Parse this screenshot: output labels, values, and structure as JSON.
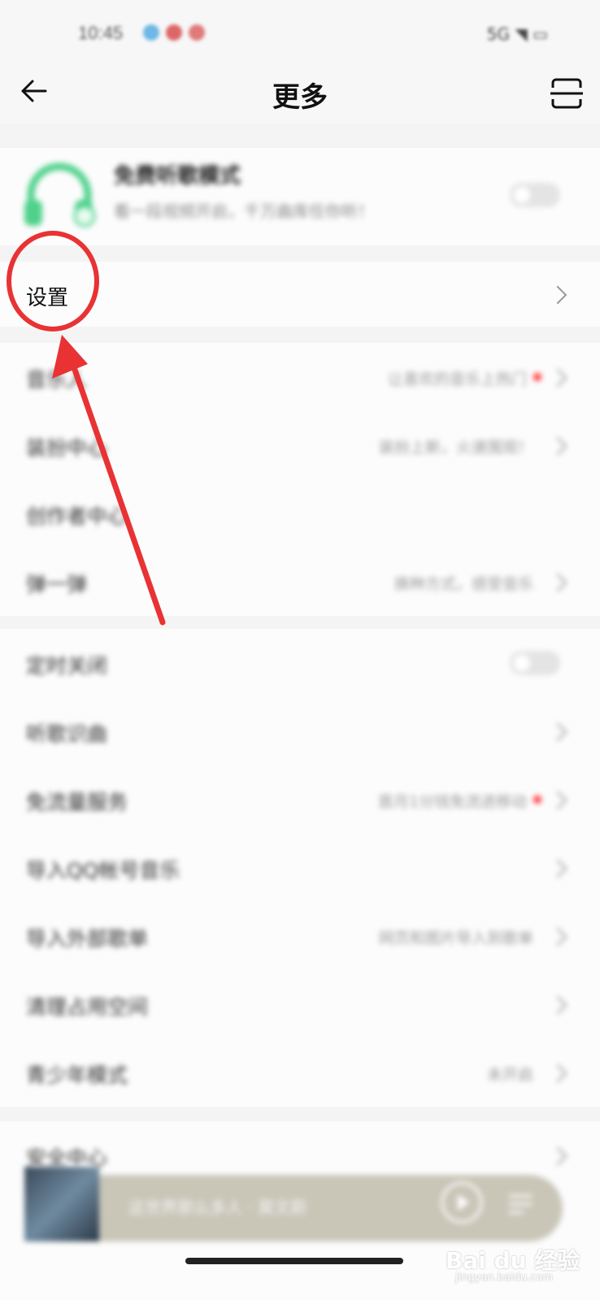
{
  "status_bar": {
    "time": "10:45",
    "right": "5G ◥ ▭"
  },
  "header": {
    "title": "更多"
  },
  "free_mode": {
    "title": "免费听歌模式",
    "subtitle": "看一段视频开启，千万曲库任你听！",
    "toggle_on": false
  },
  "settings": {
    "label": "设置"
  },
  "group1": [
    {
      "label": "音乐人",
      "sub": "让喜欢的音乐上热门",
      "dot": true
    },
    {
      "label": "装扮中心",
      "sub": "装扮上新，火速围观！",
      "dot": false
    },
    {
      "label": "创作者中心",
      "sub": "",
      "dot": false
    },
    {
      "label": "弹一弹",
      "sub": "换种方式，感受音乐",
      "dot": false
    }
  ],
  "group2": [
    {
      "label": "定时关闭",
      "sub": "",
      "dot": false
    },
    {
      "label": "听歌识曲",
      "sub": "",
      "dot": false
    },
    {
      "label": "免流量服务",
      "sub": "首月1分钱免流进移动",
      "dot": true
    },
    {
      "label": "导入QQ帐号音乐",
      "sub": "",
      "dot": false
    },
    {
      "label": "导入外部歌单",
      "sub": "网页和图片导入到歌单",
      "dot": false
    },
    {
      "label": "清理占用空间",
      "sub": "",
      "dot": false
    },
    {
      "label": "青少年模式",
      "sub": "未开启",
      "dot": false
    }
  ],
  "group3": [
    {
      "label": "安全中心",
      "sub": "",
      "dot": false
    }
  ],
  "mini_player": {
    "text": "这世界那么多人 · 莫文蔚"
  },
  "watermark": {
    "brand": "Bai du 经验",
    "url": "jingyan.baidu.com"
  },
  "colors": {
    "accent_green": "#4fd18b",
    "annotation_red": "#e83234",
    "dot_red": "#f33333"
  },
  "icons": [
    "back-arrow-icon",
    "scan-icon",
    "headphone-icon",
    "chevron-right-icon",
    "play-icon",
    "playlist-icon"
  ]
}
